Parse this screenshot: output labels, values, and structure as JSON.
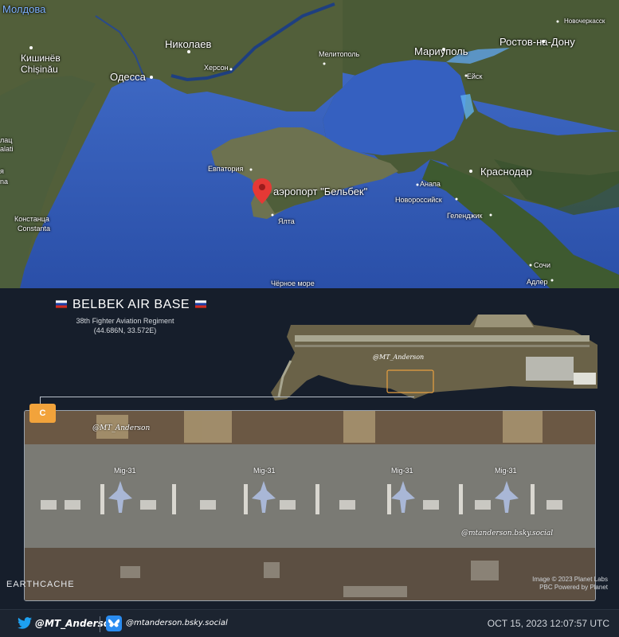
{
  "map": {
    "labels": {
      "moldova": "Молдова",
      "kishinev": "Кишинёв",
      "chisinau": "Chișinău",
      "odessa": "Одесса",
      "nikolaev": "Николаев",
      "kherson": "Херсон",
      "melitopol": "Мелитополь",
      "mariupol": "Мариуполь",
      "rostov": "Ростов-на-Дону",
      "novocherkassk": "Новочеркасск",
      "eysk": "Ейск",
      "evpatoria": "Евпатория",
      "belbek": "аэропорт \"Бельбек\"",
      "yalta": "Ялта",
      "anapa": "Анапа",
      "novorossiysk": "Новороссийск",
      "gelendzhik": "Геленджик",
      "krasnodar": "Краснодар",
      "sochi": "Сочи",
      "adler": "Адлер",
      "black_sea": "Чёрное море",
      "constanta_ru": "Констанца",
      "constanta": "Constanta",
      "galati_a": "лац",
      "galati_b": "alati",
      "left_a": "я",
      "left_b": "na"
    }
  },
  "panel": {
    "title": "BELBEK AIR BASE",
    "subtitle_line1": "38th Fighter Aviation Regiment",
    "subtitle_line2": "(44.686N, 33.572E)",
    "thumb_watermark": "@MT_Anderson",
    "badge": "C",
    "zoom_watermark_1": "@MT_Anderson",
    "zoom_watermark_2": "@mtanderson.bsky.social",
    "aircraft_label": "Mig-31",
    "credit_line1": "Image © 2023 Planet Labs",
    "credit_line2": "PBC Powered by Planet",
    "logo": "EARTHCACHE"
  },
  "footer": {
    "twitter_handle": "@MT_Anderson",
    "bluesky_handle": "@mtanderson.bsky.social",
    "datetime": "OCT 15, 2023 12:07:57 UTC"
  },
  "colors": {
    "sea": "#3d67c4",
    "land": "#4c5b3a",
    "marker": "#e53935",
    "badge": "#f2a33b",
    "panel_bg": "#161e2b"
  }
}
